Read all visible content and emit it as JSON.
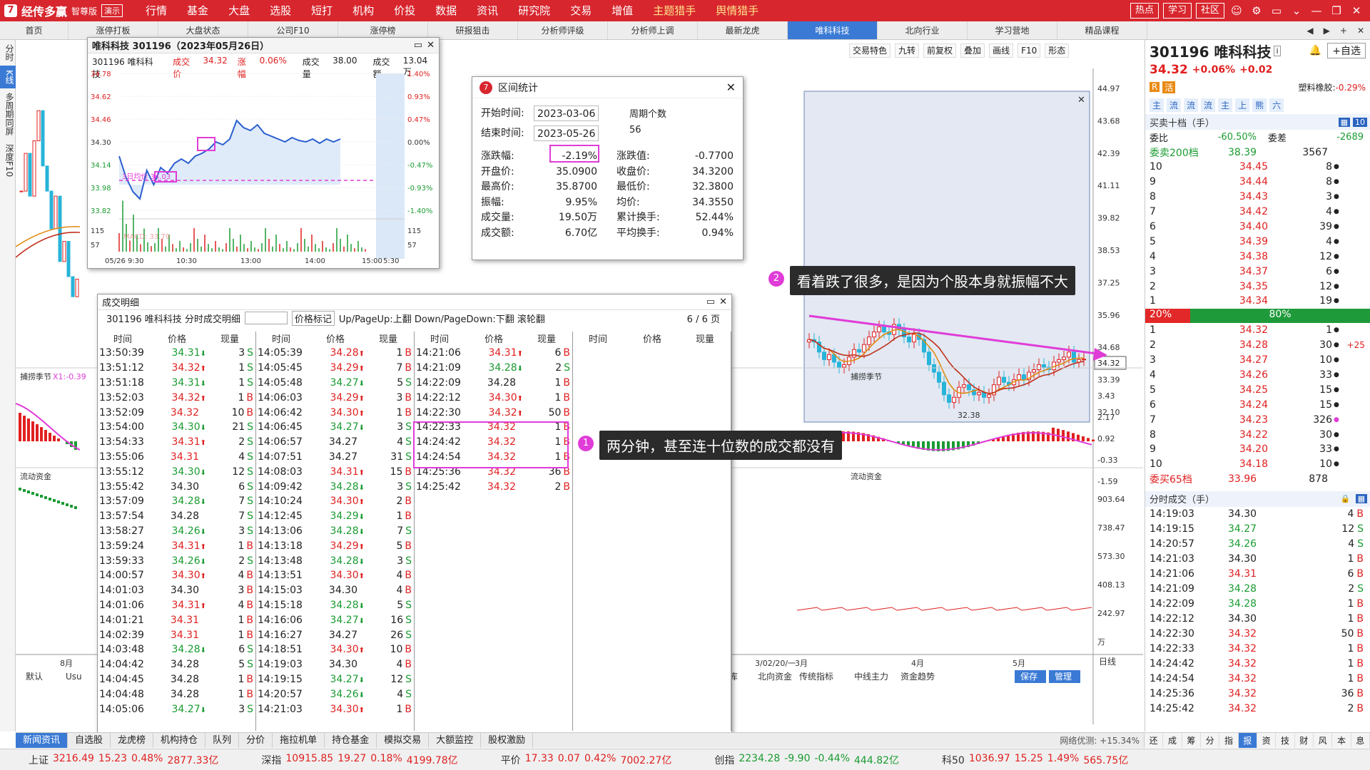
{
  "app": {
    "logo": "经传多赢",
    "edition": "智尊版",
    "demo": "演示",
    "menu": [
      "行情",
      "基金",
      "大盘",
      "选股",
      "短打",
      "机构",
      "价投",
      "数据",
      "资讯",
      "研究院",
      "交易",
      "增值",
      "主题猎手",
      "舆情猎手"
    ],
    "top_buttons": [
      "热点",
      "学习",
      "社区"
    ]
  },
  "tabs": [
    "首页",
    "涨停打板",
    "大盘状态",
    "公司F10",
    "涨停榜",
    "研报狙击",
    "分析师评级",
    "分析师上调",
    "最新龙虎",
    "唯科科技",
    "北向行业",
    "学习营地",
    "精品课程"
  ],
  "active_tab": "唯科科技",
  "rail": [
    "分时",
    "K线",
    "多周期同屏",
    "深度F10"
  ],
  "chart_toolbar": [
    "交易特色",
    "九转",
    "前复权",
    "叠加",
    "画线",
    "F10",
    "形态"
  ],
  "price_axis": [
    "44.97",
    "43.68",
    "42.39",
    "41.11",
    "39.82",
    "38.53",
    "37.25",
    "35.96",
    "34.68",
    "33.39",
    "32.10"
  ],
  "current_price_tag": "34.32",
  "low_marker": "32.38",
  "ind1": {
    "name": "捕捞季节",
    "axis": [
      "3.43",
      "2.17",
      "0.92",
      "-0.33",
      "-1.59"
    ],
    "label_x": "X1:-0.39"
  },
  "ind2": {
    "name": "流动资金",
    "axis": [
      "903.64",
      "738.47",
      "573.30",
      "408.13",
      "242.97",
      "万"
    ]
  },
  "date_axis": [
    "8月",
    "3/02/20/一",
    "3月",
    "4月",
    "5月"
  ],
  "period": "日线",
  "bottom_left_tabs": [
    "默认",
    "Usu"
  ],
  "sub_tabs": [
    "库",
    "北向资金",
    "传统指标",
    "中线主力",
    "资金趋势"
  ],
  "save_buttons": [
    "保存",
    "管理"
  ],
  "stats": {
    "title": "区间统计",
    "start_label": "开始时间:",
    "start": "2023-03-06",
    "end_label": "结束时间:",
    "end": "2023-05-26",
    "period_label": "周期个数",
    "period_count": "56",
    "rows": [
      [
        "涨跌幅:",
        "-2.19%",
        "涨跌值:",
        "-0.7700"
      ],
      [
        "开盘价:",
        "35.0900",
        "收盘价:",
        "34.3200"
      ],
      [
        "最高价:",
        "35.8700",
        "最低价:",
        "32.3800"
      ],
      [
        "振幅:",
        "9.95%",
        "均价:",
        "34.3550"
      ],
      [
        "成交量:",
        "19.50万",
        "累计换手:",
        "52.44%"
      ],
      [
        "成交额:",
        "6.70亿",
        "平均换手:",
        "0.94%"
      ]
    ]
  },
  "mini": {
    "title": "唯科科技 301196（2023年05月26日）",
    "code_name": "301196 唯科科技",
    "price_label": "成交价",
    "price": "34.32",
    "chg_label": "涨幅",
    "chg": "0.06%",
    "vol_label": "成交量",
    "vol": "38.00",
    "amt_label": "成交额",
    "amt": "13.04万",
    "y_left": [
      "34.78",
      "34.62",
      "34.46",
      "34.30",
      "34.14",
      "33.98",
      "33.82"
    ],
    "y_right": [
      "1.40%",
      "0.93%",
      "0.47%",
      "0.00%",
      "-0.47%",
      "-0.93%",
      "-1.40%"
    ],
    "vol_axis": [
      "115",
      "57",
      "115",
      "57"
    ],
    "x_axis": [
      "05/26 9:30",
      "10:30",
      "13:00",
      "14:00",
      "15:00",
      "5:30"
    ],
    "avg_label": "3日均价 34.03",
    "macd_label": "MACD: 33.79"
  },
  "deals": {
    "title": "成交明细",
    "sub": "301196 唯科科技  分时成交明细",
    "price_mark": "价格标记",
    "hint": "Up/PageUp:上翻  Down/PageDown:下翻  滚轮翻",
    "page": "6 / 6 页",
    "headers": [
      "时间",
      "价格",
      "现量"
    ],
    "cols": [
      [
        [
          "13:50:39",
          "34.31",
          "d",
          "3",
          "S"
        ],
        [
          "13:51:12",
          "34.32",
          "u",
          "1",
          "S"
        ],
        [
          "13:51:18",
          "34.31",
          "d",
          "1",
          "S"
        ],
        [
          "13:52:03",
          "34.32",
          "u",
          "1",
          "B"
        ],
        [
          "13:52:09",
          "34.32",
          "",
          "10",
          "B"
        ],
        [
          "13:54:00",
          "34.30",
          "d",
          "21",
          "S"
        ],
        [
          "13:54:33",
          "34.31",
          "u",
          "2",
          "S"
        ],
        [
          "13:55:06",
          "34.31",
          "",
          "4",
          "S"
        ],
        [
          "13:55:12",
          "34.30",
          "d",
          "12",
          "S"
        ],
        [
          "13:55:42",
          "34.30",
          "",
          "6",
          "S"
        ],
        [
          "13:57:09",
          "34.28",
          "d",
          "7",
          "S"
        ],
        [
          "13:57:54",
          "34.28",
          "",
          "7",
          "S"
        ],
        [
          "13:58:27",
          "34.26",
          "d",
          "3",
          "S"
        ],
        [
          "13:59:24",
          "34.31",
          "u",
          "1",
          "B"
        ],
        [
          "13:59:33",
          "34.26",
          "d",
          "2",
          "S"
        ],
        [
          "14:00:57",
          "34.30",
          "u",
          "4",
          "B"
        ],
        [
          "14:01:03",
          "34.30",
          "",
          "3",
          "B"
        ],
        [
          "14:01:06",
          "34.31",
          "u",
          "4",
          "B"
        ],
        [
          "14:01:21",
          "34.31",
          "",
          "1",
          "B"
        ],
        [
          "14:02:39",
          "34.31",
          "",
          "1",
          "B"
        ],
        [
          "14:03:48",
          "34.28",
          "d",
          "6",
          "S"
        ],
        [
          "14:04:42",
          "34.28",
          "",
          "5",
          "S"
        ],
        [
          "14:04:45",
          "34.28",
          "",
          "1",
          "B"
        ],
        [
          "14:04:48",
          "34.28",
          "",
          "1",
          "B"
        ],
        [
          "14:05:06",
          "34.27",
          "d",
          "3",
          "S"
        ]
      ],
      [
        [
          "14:05:39",
          "34.28",
          "u",
          "1",
          "B"
        ],
        [
          "14:05:45",
          "34.29",
          "u",
          "7",
          "B"
        ],
        [
          "14:05:48",
          "34.27",
          "d",
          "5",
          "S"
        ],
        [
          "14:06:03",
          "34.29",
          "u",
          "3",
          "B"
        ],
        [
          "14:06:42",
          "34.30",
          "u",
          "1",
          "B"
        ],
        [
          "14:06:45",
          "34.27",
          "d",
          "3",
          "S"
        ],
        [
          "14:06:57",
          "34.27",
          "",
          "4",
          "S"
        ],
        [
          "14:07:51",
          "34.27",
          "",
          "31",
          "S"
        ],
        [
          "14:08:03",
          "34.31",
          "u",
          "15",
          "B"
        ],
        [
          "14:09:42",
          "34.28",
          "d",
          "3",
          "S"
        ],
        [
          "14:10:24",
          "34.30",
          "u",
          "2",
          "B"
        ],
        [
          "14:12:45",
          "34.29",
          "d",
          "1",
          "B"
        ],
        [
          "14:13:06",
          "34.28",
          "d",
          "7",
          "S"
        ],
        [
          "14:13:18",
          "34.29",
          "u",
          "5",
          "B"
        ],
        [
          "14:13:48",
          "34.28",
          "d",
          "3",
          "S"
        ],
        [
          "14:13:51",
          "34.30",
          "u",
          "4",
          "B"
        ],
        [
          "14:15:03",
          "34.30",
          "",
          "4",
          "B"
        ],
        [
          "14:15:18",
          "34.28",
          "d",
          "5",
          "S"
        ],
        [
          "14:16:06",
          "34.27",
          "d",
          "16",
          "S"
        ],
        [
          "14:16:27",
          "34.27",
          "",
          "26",
          "S"
        ],
        [
          "14:18:51",
          "34.30",
          "u",
          "10",
          "B"
        ],
        [
          "14:19:03",
          "34.30",
          "",
          "4",
          "B"
        ],
        [
          "14:19:15",
          "34.27",
          "d",
          "12",
          "S"
        ],
        [
          "14:20:57",
          "34.26",
          "d",
          "4",
          "S"
        ],
        [
          "14:21:03",
          "34.30",
          "u",
          "1",
          "B"
        ]
      ],
      [
        [
          "14:21:06",
          "34.31",
          "u",
          "6",
          "B"
        ],
        [
          "14:21:09",
          "34.28",
          "d",
          "2",
          "S"
        ],
        [
          "14:22:09",
          "34.28",
          "",
          "1",
          "B"
        ],
        [
          "14:22:12",
          "34.30",
          "u",
          "1",
          "B"
        ],
        [
          "14:22:30",
          "34.32",
          "u",
          "50",
          "B"
        ],
        [
          "14:22:33",
          "34.32",
          "",
          "1",
          "B"
        ],
        [
          "14:24:42",
          "34.32",
          "",
          "1",
          "B"
        ],
        [
          "14:24:54",
          "34.32",
          "",
          "1",
          "B"
        ],
        [
          "14:25:36",
          "34.32",
          "",
          "36",
          "B"
        ],
        [
          "14:25:42",
          "34.32",
          "",
          "2",
          "B"
        ]
      ],
      []
    ]
  },
  "annotations": [
    {
      "num": "1",
      "text": "两分钟，甚至连十位数的成交都没有"
    },
    {
      "num": "2",
      "text": "看着跌了很多，是因为个股本身就振幅不大"
    }
  ],
  "right": {
    "name": "301196 唯科科技",
    "price": "34.32",
    "chg_pct": "+0.06%",
    "chg": "+0.02",
    "add_btn": "+自选",
    "r_tag": "R",
    "r_tag2": "活",
    "industry": "塑料橡胶:",
    "industry_chg": "-0.29%",
    "chips": [
      "主",
      "流",
      "流",
      "流",
      "主",
      "上",
      "熊",
      "六"
    ],
    "ob_title": "买卖十档（手）",
    "ratio_row": [
      "委比",
      "-60.50%",
      "委差",
      "-2689"
    ],
    "sell200": [
      "委卖200档",
      "38.39",
      "3567"
    ],
    "asks": [
      [
        "10",
        "34.45",
        "8",
        ""
      ],
      [
        "9",
        "34.44",
        "8",
        ""
      ],
      [
        "8",
        "34.43",
        "3",
        ""
      ],
      [
        "7",
        "34.42",
        "4",
        ""
      ],
      [
        "6",
        "34.40",
        "39",
        ""
      ],
      [
        "5",
        "34.39",
        "4",
        ""
      ],
      [
        "4",
        "34.38",
        "12",
        ""
      ],
      [
        "3",
        "34.37",
        "6",
        ""
      ],
      [
        "2",
        "34.35",
        "12",
        ""
      ],
      [
        "1",
        "34.34",
        "19",
        ""
      ]
    ],
    "bar_left": "20%",
    "bar_right": "80%",
    "bids": [
      [
        "1",
        "34.32",
        "1",
        ""
      ],
      [
        "2",
        "34.28",
        "30",
        "+25"
      ],
      [
        "3",
        "34.27",
        "10",
        ""
      ],
      [
        "4",
        "34.26",
        "33",
        ""
      ],
      [
        "5",
        "34.25",
        "15",
        ""
      ],
      [
        "6",
        "34.24",
        "15",
        ""
      ],
      [
        "7",
        "34.23",
        "326",
        ""
      ],
      [
        "8",
        "34.22",
        "30",
        ""
      ],
      [
        "9",
        "34.20",
        "33",
        ""
      ],
      [
        "10",
        "34.18",
        "10",
        ""
      ]
    ],
    "buy65": [
      "委买65档",
      "33.96",
      "878"
    ],
    "tick_title": "分时成交（手）",
    "ticks": [
      [
        "14:19:03",
        "34.30",
        "eq",
        "4",
        "B"
      ],
      [
        "14:19:15",
        "34.27",
        "gr",
        "12",
        "S"
      ],
      [
        "14:20:57",
        "34.26",
        "gr",
        "4",
        "S"
      ],
      [
        "14:21:03",
        "34.30",
        "eq",
        "1",
        "B"
      ],
      [
        "14:21:06",
        "34.31",
        "r",
        "6",
        "B"
      ],
      [
        "14:21:09",
        "34.28",
        "gr",
        "2",
        "S"
      ],
      [
        "14:22:09",
        "34.28",
        "gr",
        "1",
        "B"
      ],
      [
        "14:22:12",
        "34.30",
        "eq",
        "1",
        "B"
      ],
      [
        "14:22:30",
        "34.32",
        "r",
        "50",
        "B"
      ],
      [
        "14:22:33",
        "34.32",
        "r",
        "1",
        "B"
      ],
      [
        "14:24:42",
        "34.32",
        "r",
        "1",
        "B"
      ],
      [
        "14:24:54",
        "34.32",
        "r",
        "1",
        "B"
      ],
      [
        "14:25:36",
        "34.32",
        "r",
        "36",
        "B"
      ],
      [
        "14:25:42",
        "34.32",
        "r",
        "2",
        "B"
      ]
    ],
    "bottom_icons": [
      "还",
      "成",
      "筹",
      "分",
      "指",
      "报",
      "资",
      "技",
      "财",
      "风",
      "本",
      "息"
    ]
  },
  "bottom_tabs": [
    "新闻资讯",
    "自选股",
    "龙虎榜",
    "机构持仓",
    "队列",
    "分价",
    "拖拉机单",
    "持仓基金",
    "模拟交易",
    "大额监控",
    "股权激励"
  ],
  "net": "网络优测: +15.34%",
  "status": [
    {
      "name": "上证",
      "v": "3216.49",
      "c": "15.23",
      "p": "0.48%",
      "a": "2877.33亿",
      "dir": "u"
    },
    {
      "name": "深指",
      "v": "10915.85",
      "c": "19.27",
      "p": "0.18%",
      "a": "4199.78亿",
      "dir": "u"
    },
    {
      "name": "平价",
      "v": "17.33",
      "c": "0.07",
      "p": "0.42%",
      "a": "7002.27亿",
      "dir": "u"
    },
    {
      "name": "创指",
      "v": "2234.28",
      "c": "-9.90",
      "p": "-0.44%",
      "a": "444.82亿",
      "dir": "d"
    },
    {
      "name": "科50",
      "v": "1036.97",
      "c": "15.25",
      "p": "1.49%",
      "a": "565.75亿",
      "dir": "u"
    }
  ]
}
